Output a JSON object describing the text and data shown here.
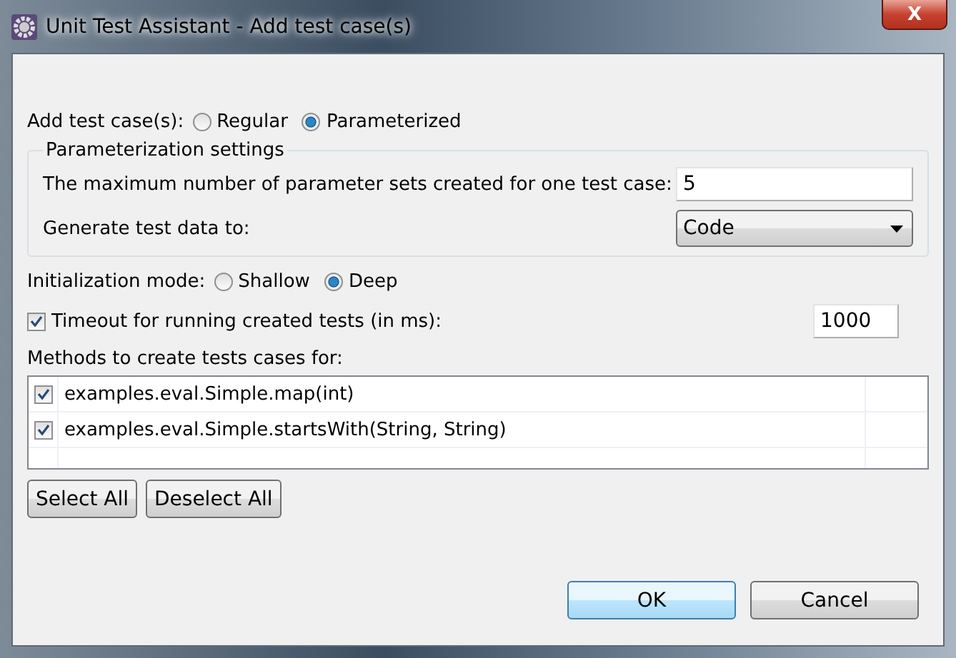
{
  "window": {
    "title": "Unit Test Assistant - Add test case(s)",
    "close": "X"
  },
  "add_test_cases": {
    "label": "Add test case(s):",
    "options": [
      {
        "label": "Regular",
        "selected": false
      },
      {
        "label": "Parameterized",
        "selected": true
      }
    ]
  },
  "parameterization": {
    "title": "Parameterization settings",
    "max_sets_label": "The maximum number of parameter sets created for one test case:",
    "max_sets_value": "5",
    "generate_label": "Generate test data to:",
    "generate_value": "Code"
  },
  "initialization": {
    "label": "Initialization mode:",
    "options": [
      {
        "label": "Shallow",
        "selected": false
      },
      {
        "label": "Deep",
        "selected": true
      }
    ]
  },
  "timeout": {
    "label": "Timeout for running created tests (in ms):",
    "checked": true,
    "value": "1000"
  },
  "methods": {
    "label": "Methods to create tests cases for:",
    "rows": [
      {
        "name": "examples.eval.Simple.map(int)",
        "checked": true
      },
      {
        "name": "examples.eval.Simple.startsWith(String, String)",
        "checked": true
      }
    ]
  },
  "list_buttons": [
    "Select All",
    "Deselect All"
  ],
  "dialog_buttons": [
    {
      "label": "OK",
      "default": true
    },
    {
      "label": "Cancel",
      "default": false
    }
  ]
}
